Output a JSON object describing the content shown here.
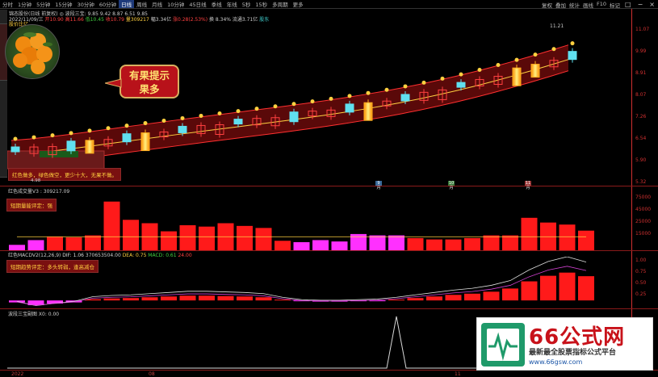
{
  "toolbar": {
    "items": [
      "分时",
      "1分钟",
      "5分钟",
      "15分钟",
      "30分钟",
      "60分钟",
      "日线",
      "周线",
      "月线",
      "10分钟",
      "45日线",
      "季线",
      "年线",
      "5秒",
      "15秒",
      "多周期",
      "更多"
    ],
    "active_index": 6,
    "right_items": [
      "复权",
      "叠加",
      "统计",
      "画线",
      "F10",
      "标记"
    ],
    "win_controls": [
      "□",
      "−",
      "×"
    ]
  },
  "main_header": {
    "line1": "锦态股份(日线 前复权) ◎ 波段三宝: 9.85   9.42   8.87   6.51   9.85",
    "line2_prefix": "2022/11/09/三",
    "line2_parts": [
      "开10.90",
      "高11.66",
      "低10.45",
      "收10.79",
      "量309217",
      "幅3.34亿",
      "涨0.28(2.53%)",
      "换 8.34%",
      "流通3.71亿",
      "股东"
    ],
    "price_marker": "11.21",
    "left_tag": "股价比亿"
  },
  "y_axis_main": [
    "11.07",
    "9.99",
    "8.91",
    "8.07",
    "7.26",
    "6.54",
    "5.90",
    "5.32"
  ],
  "callout": {
    "line1": "有果提示",
    "line2": "果多"
  },
  "info_box_main": "红色做多，绿色做空，更少十大，无果不做。",
  "info_box_main_sub": "4.98",
  "volume_panel": {
    "header": "红色成交量V3 : 309217.09",
    "info": "短期量能评定：强",
    "y_axis": [
      "75000",
      "45000",
      "25000",
      "15000"
    ]
  },
  "macd_panel": {
    "header_parts": [
      "红色MACDV2(12,26,9)",
      "DIF: 1.06",
      "370653504.00",
      "DEA: 0.75",
      "MACD: 0.61",
      "24.00"
    ],
    "info": "短期趋势评定：多头转弱，逢高减仓",
    "y_axis": [
      "1.00",
      "0.75",
      "0.50",
      "0.25"
    ]
  },
  "bottom_panel": {
    "header": "波段三宝副图  X0: 0.00"
  },
  "date_axis": [
    "2022",
    "08",
    "11"
  ],
  "mid_labels": [
    "9月",
    "10月",
    "11月"
  ],
  "watermark": {
    "title": "66公式网",
    "subtitle": "最新最全股票指标公式平台",
    "url": "www.66gsw.com"
  },
  "chart_data": {
    "type": "bar",
    "series": [
      {
        "name": "volume",
        "values": [
          8000,
          15000,
          20000,
          19000,
          22000,
          72000,
          45000,
          40000,
          28000,
          37000,
          35000,
          40000,
          36000,
          33000,
          14000,
          12000,
          15000,
          13000,
          24000,
          22000,
          22000,
          18000,
          16000,
          16000,
          18000,
          22000,
          22000,
          48000,
          41000,
          38000,
          29000
        ]
      }
    ],
    "volume_colors": [
      "m",
      "m",
      "r",
      "r",
      "r",
      "r",
      "r",
      "r",
      "r",
      "r",
      "r",
      "r",
      "r",
      "r",
      "r",
      "m",
      "m",
      "m",
      "m",
      "m",
      "m",
      "r",
      "r",
      "r",
      "r",
      "r",
      "r",
      "r",
      "r",
      "r",
      "r"
    ],
    "macd_values": [
      -0.05,
      -0.12,
      -0.08,
      -0.05,
      0.03,
      0.05,
      0.06,
      0.08,
      0.1,
      0.12,
      0.12,
      0.11,
      0.1,
      0.08,
      0.02,
      -0.02,
      -0.03,
      -0.03,
      -0.02,
      -0.01,
      0.02,
      0.06,
      0.1,
      0.14,
      0.17,
      0.22,
      0.3,
      0.48,
      0.62,
      0.7,
      0.61
    ],
    "ylim_volume": [
      0,
      80000
    ],
    "ylim_macd": [
      -0.2,
      1.1
    ]
  }
}
